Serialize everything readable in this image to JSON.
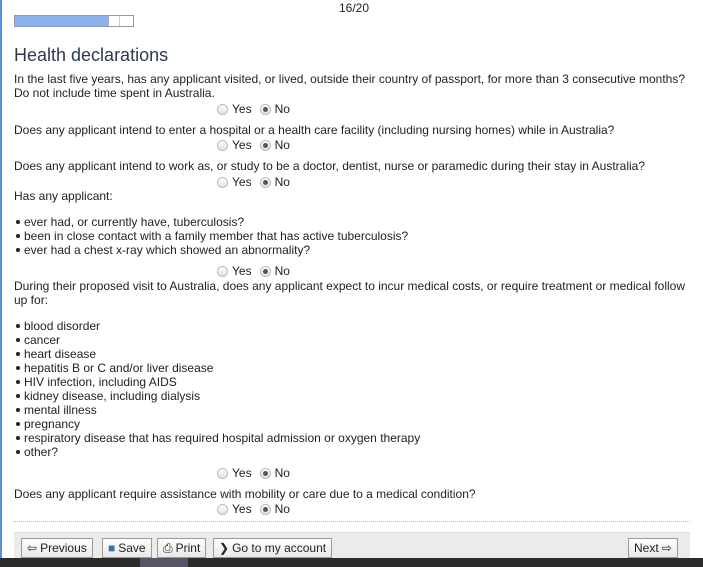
{
  "progress": {
    "counter": "16/20",
    "fraction": 0.8,
    "fill_color": "#8ab2ee"
  },
  "title": "Health declarations",
  "q1": {
    "text": "In the last five years, has any applicant visited, or lived, outside their country of passport, for more than 3 consecutive months?",
    "text2": "Do not include time spent in Australia.",
    "selected": "No"
  },
  "q2": {
    "text": "Does any applicant intend to enter a hospital or a health care facility (including nursing homes) while in Australia?",
    "selected": "No"
  },
  "q3": {
    "text": "Does any applicant intend to work as, or study to be a doctor, dentist, nurse or paramedic during their stay in Australia?",
    "selected": "No"
  },
  "q4": {
    "text": "Has any applicant:",
    "items": [
      "ever had, or currently have, tuberculosis?",
      "been in close contact with a family member that has active tuberculosis?",
      "ever had a chest x-ray which showed an abnormality?"
    ],
    "selected": "No"
  },
  "q5": {
    "text": "During their proposed visit to Australia, does any applicant expect to incur medical costs, or require treatment or medical follow",
    "text2": "up for:",
    "items": [
      "blood disorder",
      "cancer",
      "heart disease",
      "hepatitis B or C and/or liver disease",
      "HIV infection, including AIDS",
      "kidney disease, including dialysis",
      "mental illness",
      "pregnancy",
      "respiratory disease that has required hospital admission or oxygen therapy",
      "other?"
    ],
    "selected": "No"
  },
  "q6": {
    "text": "Does any applicant require assistance with mobility or care due to a medical condition?",
    "selected": "No"
  },
  "options": {
    "yes": "Yes",
    "no": "No"
  },
  "footer": {
    "previous": "Previous",
    "save": "Save",
    "print": "Print",
    "account": "Go to my account",
    "next": "Next"
  }
}
